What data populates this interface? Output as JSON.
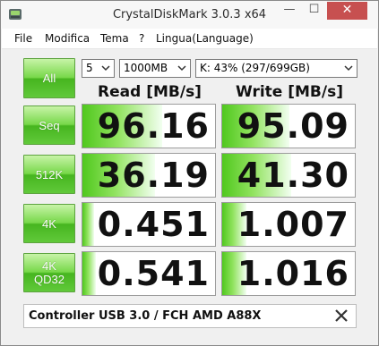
{
  "window": {
    "title": "CrystalDiskMark 3.0.3 x64",
    "minimize_glyph": "—",
    "maximize_glyph": "☐",
    "close_glyph": "✕"
  },
  "menu": [
    "File",
    "Modifica",
    "Tema",
    "?",
    "Lingua(Language)"
  ],
  "controls": {
    "all_label": "All",
    "runs": "5",
    "size": "1000MB",
    "drive": "K: 43% (297/699GB)"
  },
  "headers": {
    "read": "Read [MB/s]",
    "write": "Write [MB/s]"
  },
  "tests": [
    {
      "label": [
        "Seq"
      ],
      "read": "96.16",
      "write": "95.09",
      "read_fill": 0.6,
      "write_fill": 0.51
    },
    {
      "label": [
        "512K"
      ],
      "read": "36.19",
      "write": "41.30",
      "read_fill": 0.55,
      "write_fill": 0.52
    },
    {
      "label": [
        "4K"
      ],
      "read": "0.451",
      "write": "1.007",
      "read_fill": 0.09,
      "write_fill": 0.18
    },
    {
      "label": [
        "4K",
        "QD32"
      ],
      "read": "0.541",
      "write": "1.016",
      "read_fill": 0.1,
      "write_fill": 0.18
    }
  ],
  "comment": "Controller USB 3.0 / FCH AMD A88X",
  "icons": {
    "app": "crystaldiskmark-icon",
    "clear_comment": "close-x-icon",
    "dropdown": "chevron-down-icon"
  },
  "colors": {
    "button_green": "#61c93a",
    "bar_green": "#50c81e",
    "close_red": "#c75050"
  }
}
